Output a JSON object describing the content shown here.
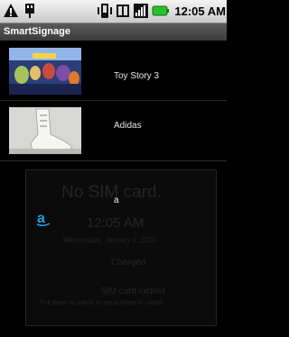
{
  "status_bar": {
    "time": "12:05 AM",
    "icons": [
      "warning-icon",
      "usb-icon",
      "vibrate-icon",
      "sim-card-icon",
      "signal-icon",
      "battery-icon"
    ]
  },
  "app": {
    "title": "SmartSignage"
  },
  "list": {
    "items": [
      {
        "label": "Toy Story 3",
        "thumbnail": "toy-story-poster"
      },
      {
        "label": "Adidas",
        "thumbnail": "adidas-shoe-poster"
      }
    ]
  },
  "notification": {
    "text": "a",
    "icon": "amazon-icon",
    "icon_color": "#1ca0e2"
  },
  "lockscreen_faint": {
    "no_sim": "No SIM card.",
    "time": "12:05 AM",
    "date": "Wednesday, January 1, 2020",
    "charge": "Charged",
    "sim_locked": "SIM card locked",
    "hint": "Pull down to unlock or press Menu to unlock"
  }
}
